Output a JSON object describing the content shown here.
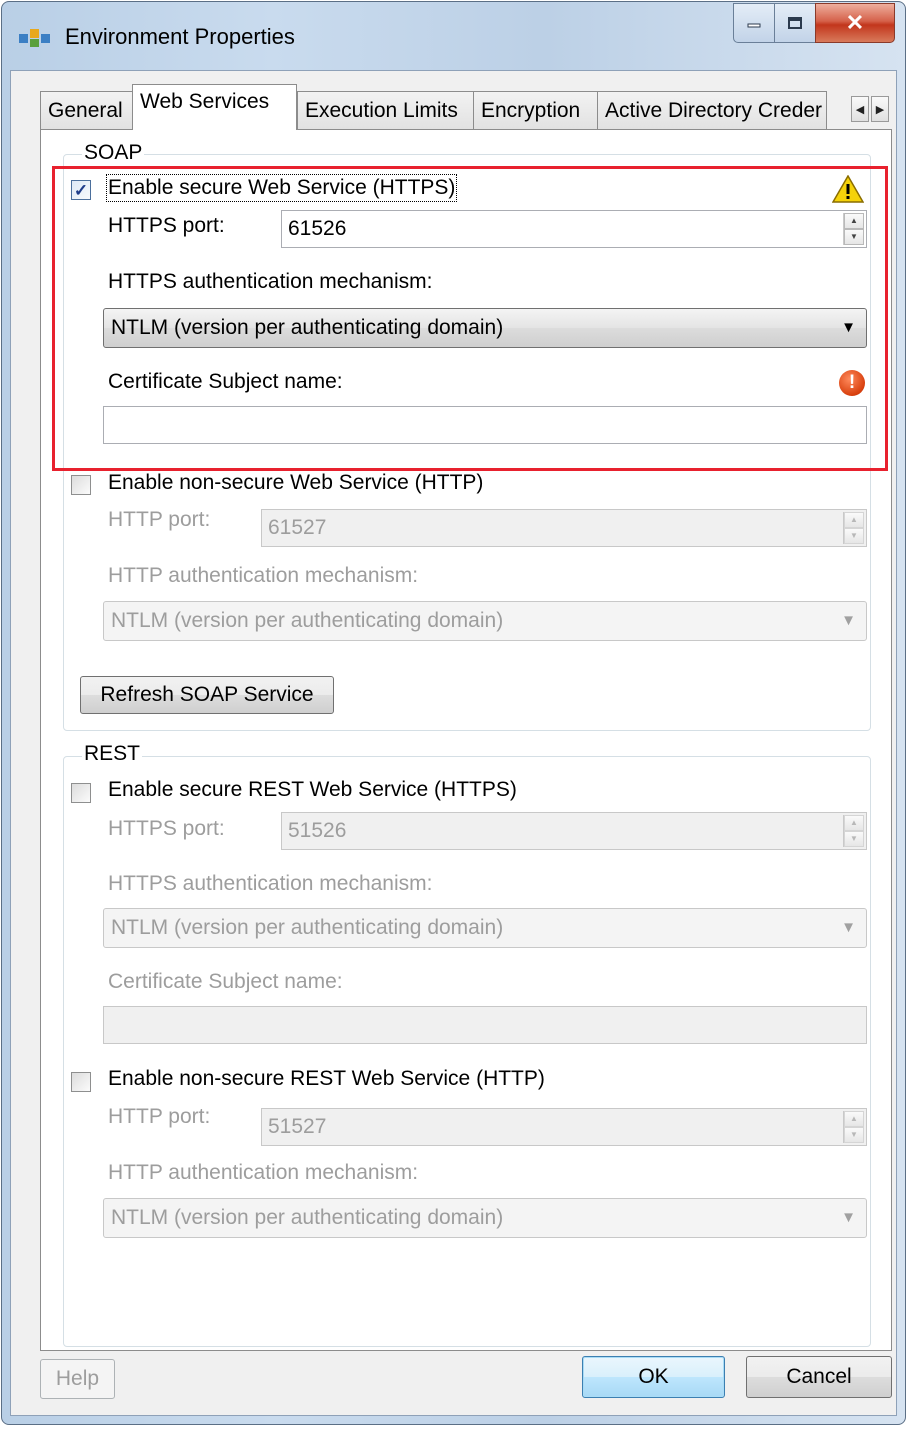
{
  "window": {
    "title": "Environment Properties",
    "controls": {
      "minimize": "minimize",
      "maximize": "maximize",
      "close": "close"
    }
  },
  "tabs": [
    {
      "label": "General"
    },
    {
      "label": "Web Services"
    },
    {
      "label": "Execution Limits"
    },
    {
      "label": "Encryption"
    },
    {
      "label": "Active Directory Creder"
    }
  ],
  "soap": {
    "group_label": "SOAP",
    "https": {
      "checkbox_label": "Enable secure Web Service (HTTPS)",
      "checked": true,
      "port_label": "HTTPS port:",
      "port_value": "61526",
      "auth_label": "HTTPS authentication mechanism:",
      "auth_value": "NTLM (version per authenticating domain)",
      "cert_label": "Certificate Subject name:",
      "cert_value": ""
    },
    "http": {
      "checkbox_label": "Enable non-secure Web Service (HTTP)",
      "checked": false,
      "port_label": "HTTP port:",
      "port_value": "61527",
      "auth_label": "HTTP authentication mechanism:",
      "auth_value": "NTLM (version per authenticating domain)"
    },
    "refresh_button": "Refresh SOAP Service"
  },
  "rest": {
    "group_label": "REST",
    "https": {
      "checkbox_label": "Enable secure REST Web Service (HTTPS)",
      "checked": false,
      "port_label": "HTTPS port:",
      "port_value": "51526",
      "auth_label": "HTTPS authentication mechanism:",
      "auth_value": "NTLM (version per authenticating domain)",
      "cert_label": "Certificate Subject name:",
      "cert_value": ""
    },
    "http": {
      "checkbox_label": "Enable non-secure REST Web Service (HTTP)",
      "checked": false,
      "port_label": "HTTP port:",
      "port_value": "51527",
      "auth_label": "HTTP authentication mechanism:",
      "auth_value": "NTLM (version per authenticating domain)"
    }
  },
  "footer": {
    "help_button": "Help",
    "ok_button": "OK",
    "cancel_button": "Cancel"
  },
  "colors": {
    "highlight_box": "#e8212e",
    "warning": "#f5d20a",
    "error": "#d8400e"
  }
}
